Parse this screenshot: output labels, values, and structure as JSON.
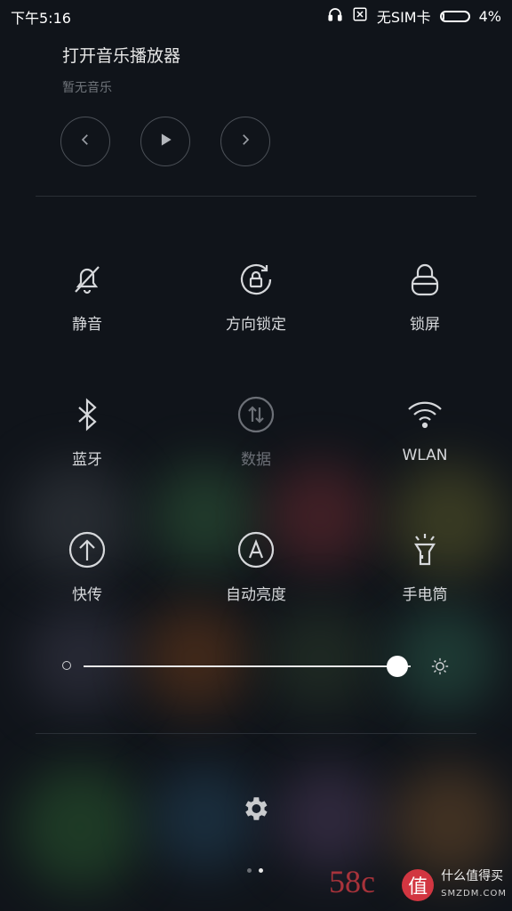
{
  "status_bar": {
    "time": "下午5:16",
    "sim_text": "无SIM卡",
    "battery_text": "4%",
    "battery_level": 0.04,
    "icons": [
      "headphones-icon",
      "no-sim-icon",
      "battery-icon"
    ]
  },
  "music": {
    "title": "打开音乐播放器",
    "subtitle": "暂无音乐",
    "controls": [
      "previous-icon",
      "play-icon",
      "next-icon"
    ]
  },
  "toggles": [
    {
      "label": "静音",
      "icon": "mute-bell-icon",
      "active": false
    },
    {
      "label": "方向锁定",
      "icon": "rotation-lock-icon",
      "active": false
    },
    {
      "label": "锁屏",
      "icon": "lock-icon",
      "active": false
    },
    {
      "label": "蓝牙",
      "icon": "bluetooth-icon",
      "active": false
    },
    {
      "label": "数据",
      "icon": "mobile-data-icon",
      "active": false,
      "dimmed": true
    },
    {
      "label": "WLAN",
      "icon": "wifi-icon",
      "active": false
    },
    {
      "label": "快传",
      "icon": "quick-transfer-icon",
      "active": false
    },
    {
      "label": "自动亮度",
      "icon": "auto-brightness-icon",
      "active": false
    },
    {
      "label": "手电筒",
      "icon": "flashlight-icon",
      "active": false
    }
  ],
  "brightness": {
    "level": 0.96,
    "icons": [
      "brightness-low-icon",
      "brightness-high-icon"
    ]
  },
  "settings": {
    "icon": "gear-icon"
  },
  "pager": {
    "pages": 2,
    "active_index": 1
  },
  "watermark": {
    "site_text": "58c",
    "badge_char": "值",
    "brand_text": "什么值得买",
    "brand_url": "SMZDM.COM"
  },
  "colors": {
    "background": "#10141a",
    "text_primary": "#d6d8db",
    "text_dim": "#6c7077",
    "accent_watermark": "#d23641"
  }
}
